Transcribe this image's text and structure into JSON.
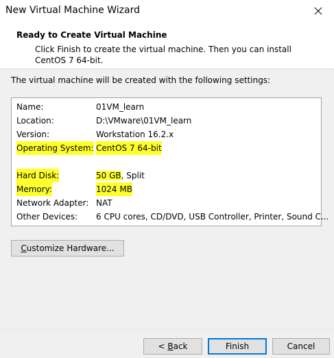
{
  "window": {
    "title": "New Virtual Machine Wizard",
    "close_icon": "close-icon"
  },
  "header": {
    "title": "Ready to Create Virtual Machine",
    "description": "Click Finish to create the virtual machine. Then you can install CentOS 7 64-bit."
  },
  "intro": "The virtual machine will be created with the following settings:",
  "settings": {
    "highlight_color": "#ffff2e",
    "rows": [
      {
        "label": "Name:",
        "value": "01VM_learn"
      },
      {
        "label": "Location:",
        "value": "D:\\VMware\\01VM_learn"
      },
      {
        "label": "Version:",
        "value": "Workstation 16.2.x"
      },
      {
        "label": "Operating System:",
        "value": "CentOS 7 64-bit"
      },
      {
        "label": "Hard Disk:",
        "value_main": "50 GB",
        "value_rest": ", Split"
      },
      {
        "label": "Memory:",
        "value": "1024 MB"
      },
      {
        "label": "Network Adapter:",
        "value": "NAT"
      },
      {
        "label": "Other Devices:",
        "value": "6 CPU cores, CD/DVD, USB Controller, Printer, Sound C..."
      }
    ]
  },
  "buttons": {
    "customize": {
      "mnemonic": "C",
      "rest": "ustomize Hardware..."
    },
    "back": {
      "prefix": "< ",
      "mnemonic": "B",
      "rest": "ack"
    },
    "finish": "Finish",
    "cancel": "Cancel"
  }
}
